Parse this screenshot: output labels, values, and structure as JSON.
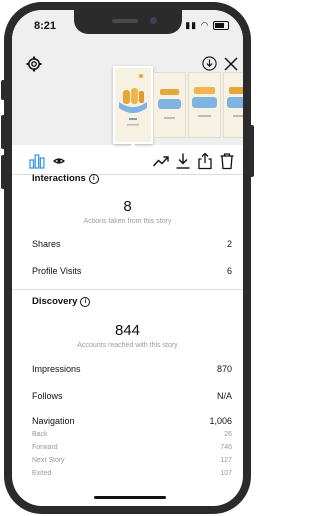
{
  "status_bar": {
    "time": "8:21"
  },
  "insights": {
    "interactions": {
      "title": "Interactions",
      "total": "8",
      "caption": "Actions taken from this story",
      "rows": [
        {
          "label": "Shares",
          "value": "2"
        },
        {
          "label": "Profile Visits",
          "value": "6"
        }
      ]
    },
    "discovery": {
      "title": "Discovery",
      "total": "844",
      "caption": "Accounts reached with this story",
      "rows": [
        {
          "label": "Impressions",
          "value": "870"
        },
        {
          "label": "Follows",
          "value": "N/A"
        },
        {
          "label": "Navigation",
          "value": "1,006"
        }
      ],
      "navigation_breakdown": [
        {
          "label": "Back",
          "value": "26"
        },
        {
          "label": "Forward",
          "value": "746"
        },
        {
          "label": "Next Story",
          "value": "127"
        },
        {
          "label": "Exited",
          "value": "107"
        }
      ]
    }
  },
  "colors": {
    "accent": "#3897f0",
    "text": "#111111",
    "muted": "#9a9a9a",
    "divider": "#dbdbdb"
  }
}
